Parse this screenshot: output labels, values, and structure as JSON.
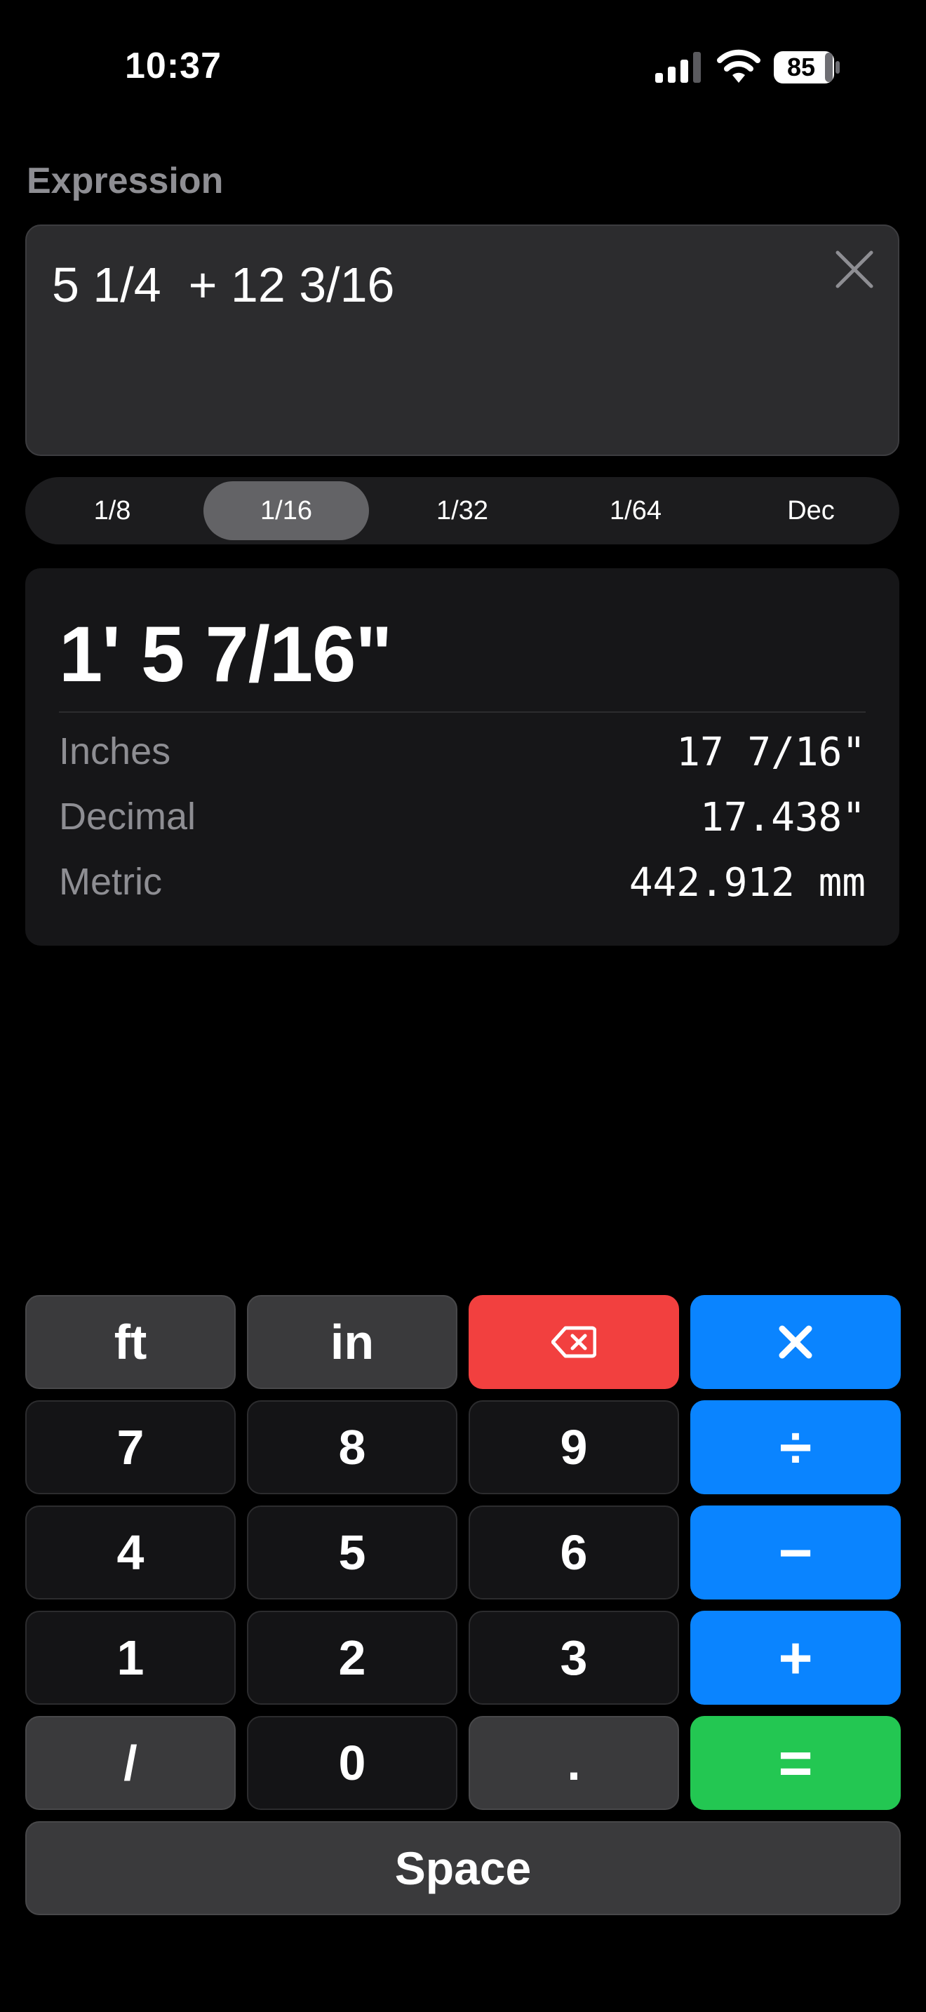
{
  "status_bar": {
    "time": "10:37",
    "battery_level": "85"
  },
  "expression": {
    "label": "Expression",
    "value": "5 1/4  + 12 3/16"
  },
  "precision": {
    "options": [
      "1/8",
      "1/16",
      "1/32",
      "1/64",
      "Dec"
    ],
    "selected": "1/16"
  },
  "result": {
    "main": "1' 5 7/16\"",
    "rows": [
      {
        "label": "Inches",
        "value": "17 7/16\""
      },
      {
        "label": "Decimal",
        "value": "17.438\""
      },
      {
        "label": "Metric",
        "value": "442.912 mm"
      }
    ]
  },
  "keypad": {
    "ft": "ft",
    "in": "in",
    "backspace_icon": "backspace-icon",
    "multiply_icon": "multiply-icon",
    "seven": "7",
    "eight": "8",
    "nine": "9",
    "divide": "÷",
    "four": "4",
    "five": "5",
    "six": "6",
    "minus": "−",
    "one": "1",
    "two": "2",
    "three": "3",
    "plus": "+",
    "slash": "/",
    "zero": "0",
    "dot": ".",
    "equals": "=",
    "space": "Space"
  },
  "colors": {
    "background": "#000000",
    "operator_blue": "#0a84ff",
    "backspace_red": "#f2403f",
    "equals_green": "#23c752",
    "label_gray": "#8e8e93"
  }
}
